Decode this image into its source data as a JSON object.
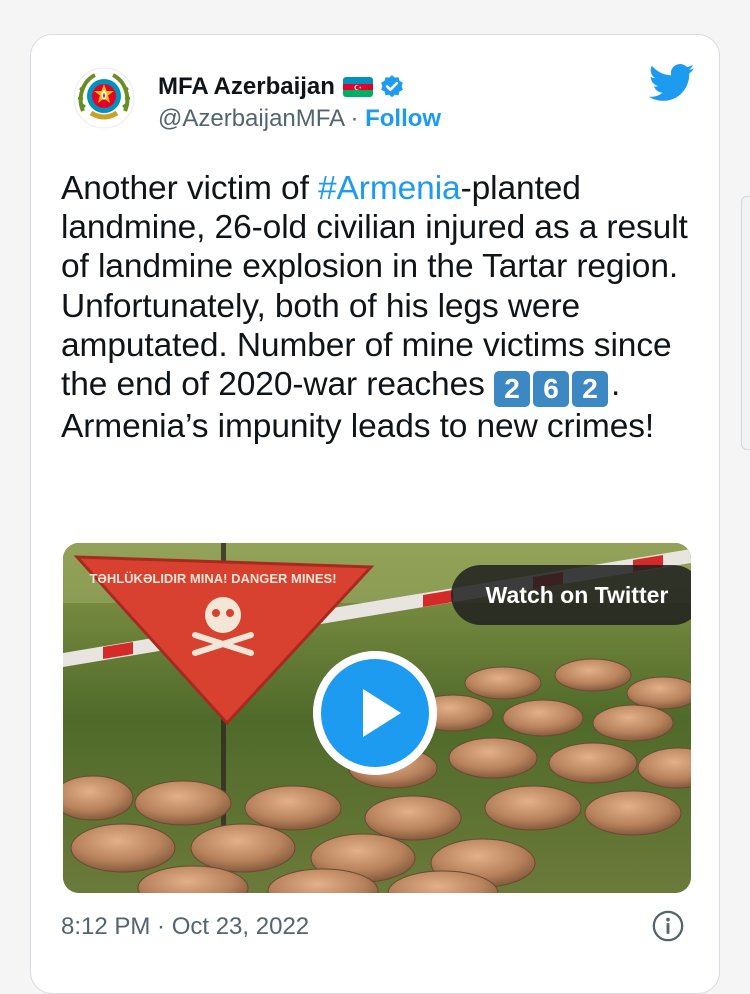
{
  "account": {
    "name": "MFA Azerbaijan",
    "handle": "@AzerbaijanMFA",
    "separator": " · ",
    "follow_label": "Follow"
  },
  "tweet": {
    "text_before_hashtag": "Another victim of ",
    "hashtag": "#Armenia",
    "text_after_hashtag": "-planted landmine, 26-old civilian injured as a result of landmine explosion in the Tartar region. Unfortunately, both of his legs were amputated. Number of mine victims since the end of 2020-war reaches ",
    "keycaps": [
      "2",
      "6",
      "2"
    ],
    "text_end": ". Armenia’s impunity leads to new crimes!"
  },
  "media": {
    "watch_label": "Watch on Twitter",
    "sign_text": "TƏHLÜKƏLIDIR MINA! DANGER MINES!"
  },
  "footer": {
    "timestamp": "8:12 PM · Oct 23, 2022"
  },
  "icons": {
    "verified": "verified-badge-icon",
    "bird": "twitter-bird-icon",
    "play": "play-icon",
    "info": "info-icon",
    "flag": "azerbaijan-flag-icon"
  },
  "colors": {
    "accent": "#1d9bf0",
    "text": "#0f1419",
    "muted": "#536471",
    "keycap": "#3b88c3"
  }
}
